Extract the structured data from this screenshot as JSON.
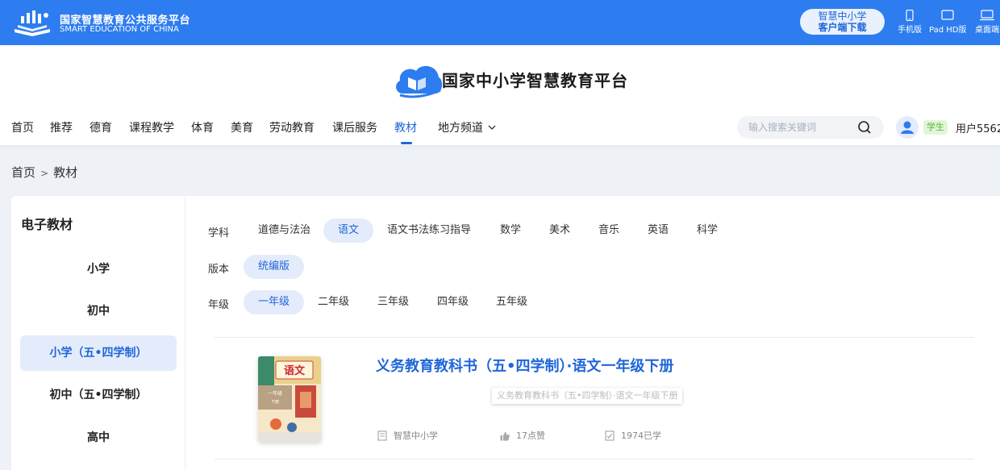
{
  "topbar": {
    "brand_cn": "国家智慧教育公共服务平台",
    "brand_en": "SMART EDUCATION OF CHINA",
    "download_line1": "智慧中小学",
    "download_line2": "客户端下载",
    "platforms": [
      {
        "label": "手机版",
        "icon": "phone-icon"
      },
      {
        "label": "Pad HD版",
        "icon": "tablet-icon"
      },
      {
        "label": "桌面端",
        "icon": "desktop-icon"
      }
    ]
  },
  "header": {
    "title": "国家中小学智慧教育平台",
    "nav": [
      "首页",
      "推荐",
      "德育",
      "课程教学",
      "体育",
      "美育",
      "劳动教育",
      "课后服务",
      "教材",
      "地方频道"
    ],
    "active_nav": "教材",
    "search_placeholder": "输入搜索关键词",
    "role_badge": "学生",
    "username": "用户5562"
  },
  "breadcrumb": {
    "home": "首页",
    "sep": ">",
    "current": "教材"
  },
  "sidebar": {
    "title": "电子教材",
    "items": [
      "小学",
      "初中",
      "小学（五•四学制）",
      "初中（五•四学制）",
      "高中"
    ],
    "active": "小学（五•四学制）"
  },
  "filters": {
    "subject_label": "学科",
    "subjects": [
      "道德与法治",
      "语文",
      "语文书法练习指导",
      "数学",
      "美术",
      "音乐",
      "英语",
      "科学"
    ],
    "subject_active": "语文",
    "edition_label": "版本",
    "editions": [
      "统编版"
    ],
    "edition_active": "统编版",
    "grade_label": "年级",
    "grades": [
      "一年级",
      "二年级",
      "三年级",
      "四年级",
      "五年级"
    ],
    "grade_active": "一年级"
  },
  "book": {
    "title": "义务教育教科书（五•四学制）·语文一年级下册",
    "tooltip": "义务教育教科书（五•四学制）·语文一年级下册",
    "publisher": "智慧中小学",
    "likes": "17点赞",
    "learners": "1974已学",
    "cover_title": "语文",
    "cover_grade": "一年级",
    "cover_volume": "下册"
  },
  "colors": {
    "primary": "#2d7cf0",
    "accent": "#1f66d8",
    "active_bg": "#e4ecfb",
    "badge_green": "#5bb43a"
  }
}
